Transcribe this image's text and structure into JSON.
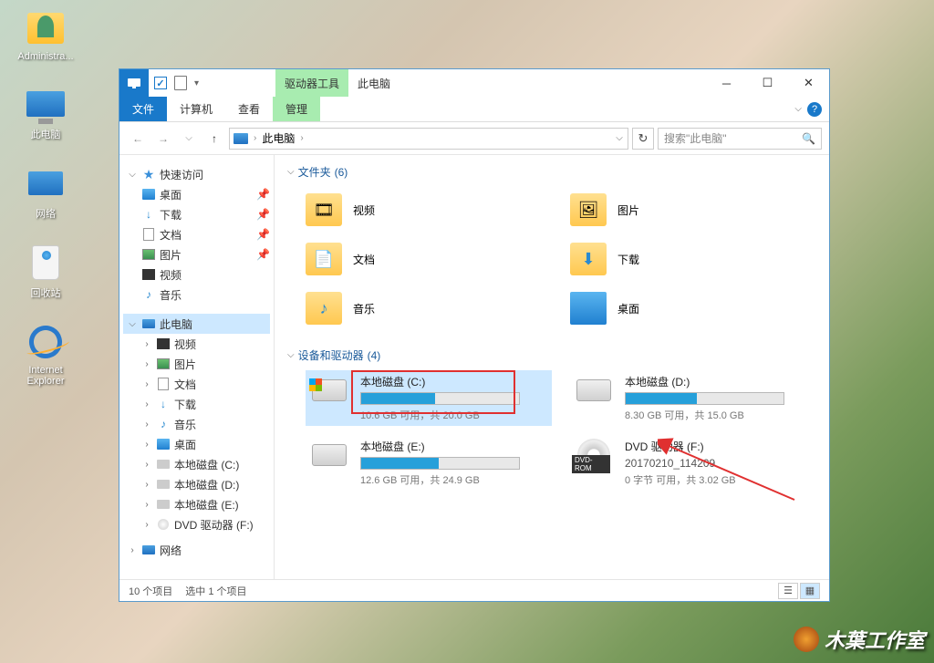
{
  "desktop": {
    "icons": [
      {
        "label": "Administra..."
      },
      {
        "label": "此电脑"
      },
      {
        "label": "网络"
      },
      {
        "label": "回收站"
      },
      {
        "label": "Internet Explorer"
      }
    ]
  },
  "window": {
    "contextual_tab": "驱动器工具",
    "title": "此电脑",
    "ribbon_tabs": {
      "file": "文件",
      "computer": "计算机",
      "view": "查看",
      "manage": "管理"
    },
    "nav": {
      "breadcrumb": "此电脑",
      "search_placeholder": "搜索\"此电脑\""
    },
    "sidebar": {
      "quick_access": "快速访问",
      "items_qa": [
        "桌面",
        "下载",
        "文档",
        "图片",
        "视频",
        "音乐"
      ],
      "this_pc": "此电脑",
      "items_pc": [
        "视频",
        "图片",
        "文档",
        "下载",
        "音乐",
        "桌面",
        "本地磁盘 (C:)",
        "本地磁盘 (D:)",
        "本地磁盘 (E:)",
        "DVD 驱动器 (F:)"
      ],
      "network": "网络"
    },
    "folders_section": {
      "title": "文件夹",
      "count": "(6)"
    },
    "folders": [
      {
        "label": "视频"
      },
      {
        "label": "图片"
      },
      {
        "label": "文档"
      },
      {
        "label": "下载"
      },
      {
        "label": "音乐"
      },
      {
        "label": "桌面"
      }
    ],
    "drives_section": {
      "title": "设备和驱动器",
      "count": "(4)"
    },
    "drives": [
      {
        "name": "本地磁盘 (C:)",
        "stats": "10.6 GB 可用，共 20.0 GB",
        "fill": 47
      },
      {
        "name": "本地磁盘 (D:)",
        "stats": "8.30 GB 可用，共 15.0 GB",
        "fill": 45
      },
      {
        "name": "本地磁盘 (E:)",
        "stats": "12.6 GB 可用，共 24.9 GB",
        "fill": 49
      },
      {
        "name": "DVD 驱动器 (F:)",
        "sub": "20170210_114209",
        "stats": "0 字节 可用，共 3.02 GB"
      }
    ],
    "status": {
      "items": "10 个项目",
      "selected": "选中 1 个项目"
    }
  },
  "watermark": "木葉工作室"
}
